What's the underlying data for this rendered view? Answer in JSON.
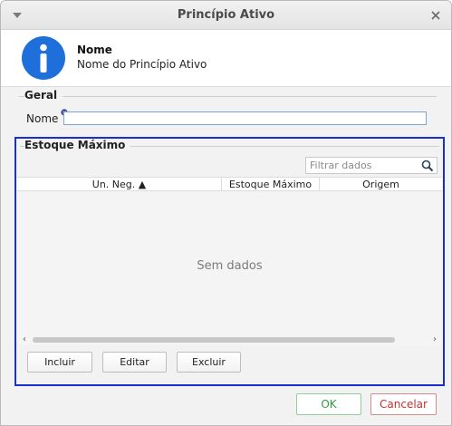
{
  "window": {
    "title": "Princípio Ativo"
  },
  "header": {
    "title": "Nome",
    "subtitle": "Nome do Princípio Ativo"
  },
  "general": {
    "group_title": "Geral",
    "name_label": "Nome",
    "name_value": ""
  },
  "stock": {
    "group_title": "Estoque Máximo",
    "filter_placeholder": "Filtrar dados",
    "columns": [
      "Un. Neg. ▲",
      "Estoque Máximo",
      "Origem"
    ],
    "empty_message": "Sem dados",
    "buttons": {
      "add": "Incluir",
      "edit": "Editar",
      "delete": "Excluir"
    }
  },
  "footer": {
    "ok": "OK",
    "cancel": "Cancelar"
  },
  "colors": {
    "accent_blue": "#1a2fd1",
    "ok_green": "#2f9a3d",
    "cancel_red": "#c53030",
    "info_blue": "#1e6fd9"
  },
  "icons": [
    "window-menu-icon",
    "close-icon",
    "info-icon",
    "required-icon",
    "search-icon",
    "scroll-left-icon",
    "scroll-right-icon"
  ]
}
